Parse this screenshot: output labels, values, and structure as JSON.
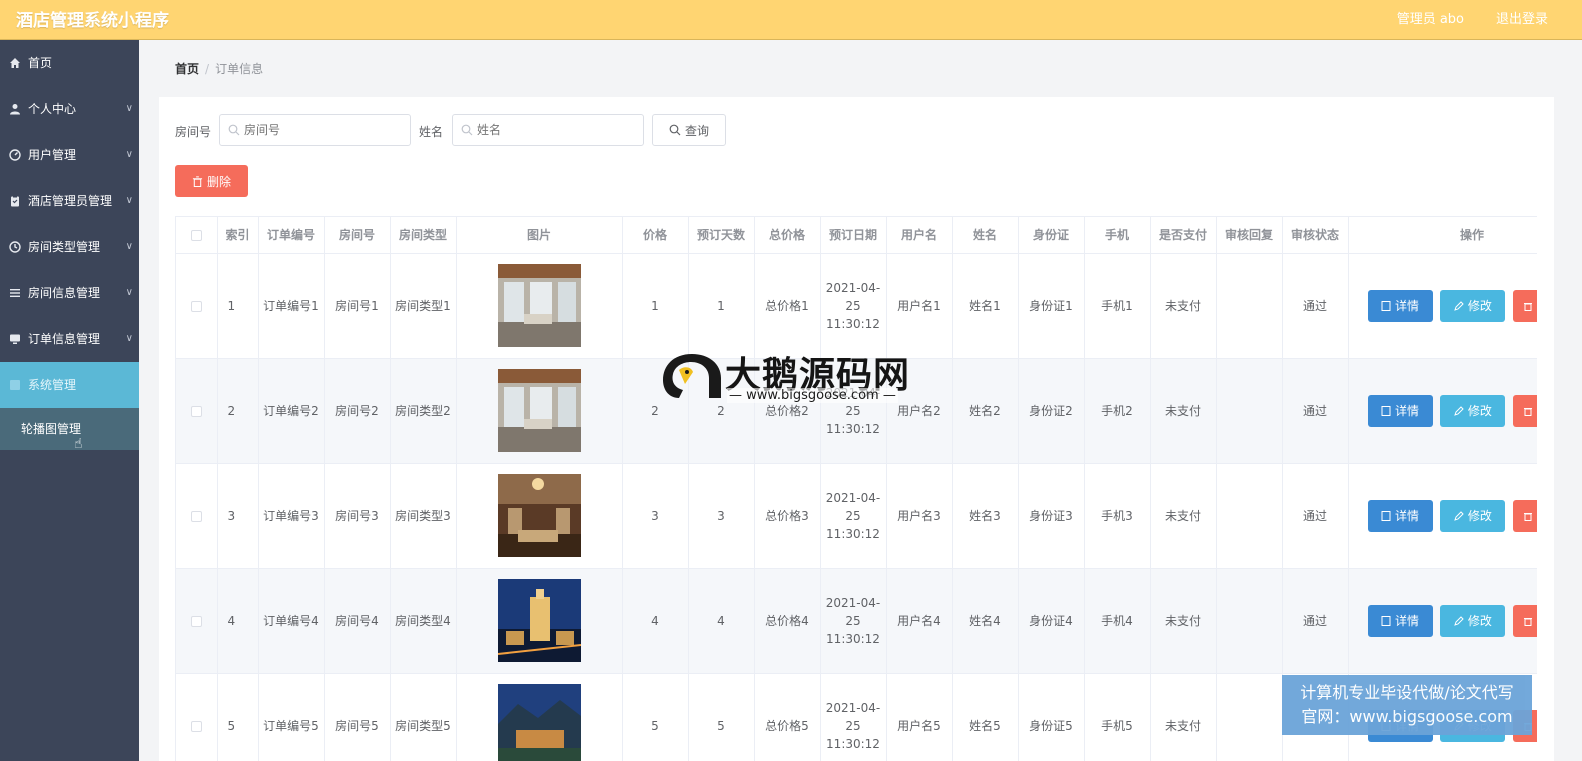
{
  "app": {
    "title": "酒店管理系统小程序",
    "user": "管理员 abo",
    "logout": "退出登录"
  },
  "sidebar": {
    "items": [
      {
        "label": "首页",
        "icon": "home-icon"
      },
      {
        "label": "个人中心",
        "icon": "user-icon"
      },
      {
        "label": "用户管理",
        "icon": "gauge-icon"
      },
      {
        "label": "酒店管理员管理",
        "icon": "clipboard-icon"
      },
      {
        "label": "房间类型管理",
        "icon": "clock-icon"
      },
      {
        "label": "房间信息管理",
        "icon": "list-icon"
      },
      {
        "label": "订单信息管理",
        "icon": "monitor-icon"
      },
      {
        "label": "系统管理",
        "icon": "grid-icon"
      }
    ],
    "sub_item": "轮播图管理"
  },
  "breadcrumb": {
    "home": "首页",
    "separator": "/",
    "current": "订单信息"
  },
  "search": {
    "room_label": "房间号",
    "room_placeholder": "房间号",
    "name_label": "姓名",
    "name_placeholder": "姓名",
    "query_label": "查询"
  },
  "toolbar": {
    "delete_label": "删除"
  },
  "table": {
    "headers": [
      "索引",
      "订单编号",
      "房间号",
      "房间类型",
      "图片",
      "价格",
      "预订天数",
      "总价格",
      "预订日期",
      "用户名",
      "姓名",
      "身份证",
      "手机",
      "是否支付",
      "审核回复",
      "审核状态",
      "操作"
    ],
    "detail_label": "详情",
    "edit_label": "修改",
    "rows": [
      {
        "index": "1",
        "order_no": "订单编号1",
        "room_no": "房间号1",
        "room_type": "房间类型1",
        "price": "1",
        "days": "1",
        "total": "总价格1",
        "date": "2021-04-25 11:30:12",
        "username": "用户名1",
        "name": "姓名1",
        "id_card": "身份证1",
        "phone": "手机1",
        "paid": "未支付",
        "reply": "",
        "status": "通过"
      },
      {
        "index": "2",
        "order_no": "订单编号2",
        "room_no": "房间号2",
        "room_type": "房间类型2",
        "price": "2",
        "days": "2",
        "total": "总价格2",
        "date": "2021-04-25 11:30:12",
        "username": "用户名2",
        "name": "姓名2",
        "id_card": "身份证2",
        "phone": "手机2",
        "paid": "未支付",
        "reply": "",
        "status": "通过"
      },
      {
        "index": "3",
        "order_no": "订单编号3",
        "room_no": "房间号3",
        "room_type": "房间类型3",
        "price": "3",
        "days": "3",
        "total": "总价格3",
        "date": "2021-04-25 11:30:12",
        "username": "用户名3",
        "name": "姓名3",
        "id_card": "身份证3",
        "phone": "手机3",
        "paid": "未支付",
        "reply": "",
        "status": "通过"
      },
      {
        "index": "4",
        "order_no": "订单编号4",
        "room_no": "房间号4",
        "room_type": "房间类型4",
        "price": "4",
        "days": "4",
        "total": "总价格4",
        "date": "2021-04-25 11:30:12",
        "username": "用户名4",
        "name": "姓名4",
        "id_card": "身份证4",
        "phone": "手机4",
        "paid": "未支付",
        "reply": "",
        "status": "通过"
      },
      {
        "index": "5",
        "order_no": "订单编号5",
        "room_no": "房间号5",
        "room_type": "房间类型5",
        "price": "5",
        "days": "5",
        "total": "总价格5",
        "date": "2021-04-25 11:30:12",
        "username": "用户名5",
        "name": "姓名5",
        "id_card": "身份证5",
        "phone": "手机5",
        "paid": "未支付",
        "reply": "",
        "status": ""
      }
    ]
  },
  "watermark": {
    "title": "大鹅源码网",
    "url": "— www.bigsgoose.com —"
  },
  "ad_banner": {
    "line1": "计算机专业毕设代做/论文代写",
    "line2": "官网：www.bigsgoose.com"
  }
}
